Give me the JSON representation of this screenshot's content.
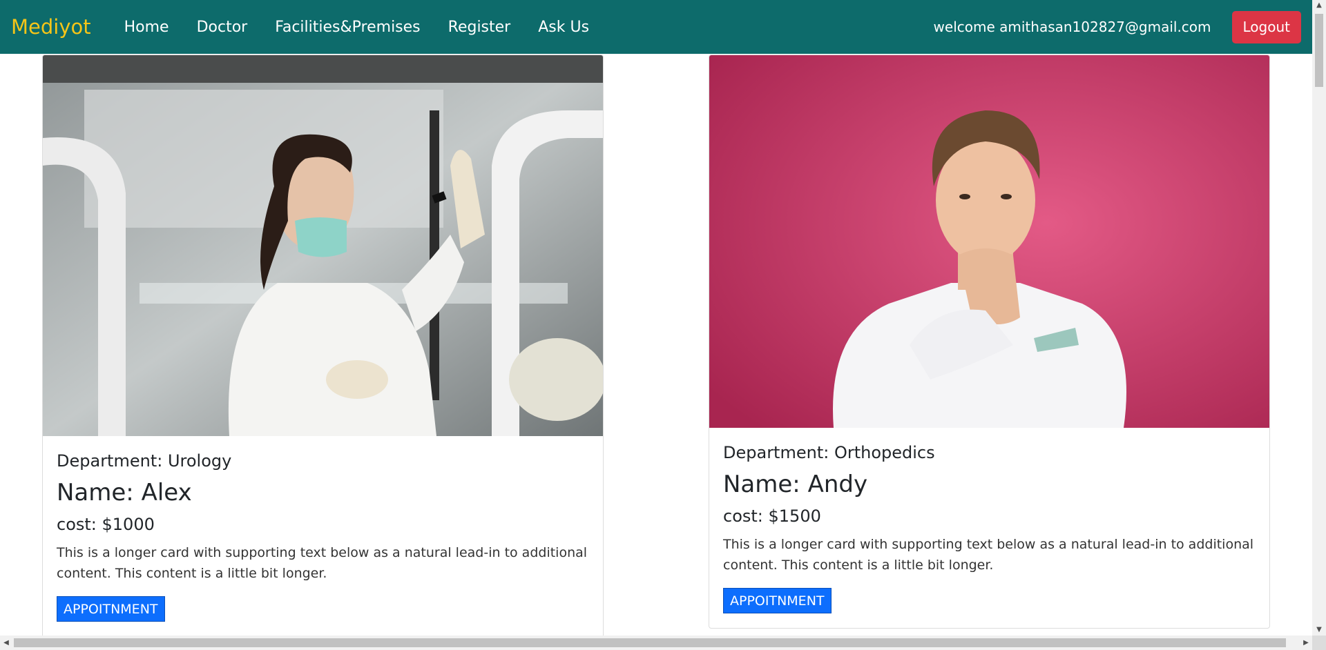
{
  "nav": {
    "brand": "Mediyot",
    "links": [
      "Home",
      "Doctor",
      "Facilities&Premises",
      "Register",
      "Ask Us"
    ],
    "welcome": "welcome amithasan102827@gmail.com",
    "logout_label": "Logout"
  },
  "doctors": [
    {
      "department": "Department: Urology",
      "name": "Name: Alex",
      "cost": "cost: $1000",
      "description": "This is a longer card with supporting text below as a natural lead-in to additional content. This content is a little bit longer.",
      "button_label": "APPOITNMENT"
    },
    {
      "department": "Department: Orthopedics",
      "name": "Name: Andy",
      "cost": "cost: $1500",
      "description": "This is a longer card with supporting text below as a natural lead-in to additional content. This content is a little bit longer.",
      "button_label": "APPOITNMENT"
    }
  ],
  "colors": {
    "navbar": "#0d6b6b",
    "brand": "#f5c518",
    "logout": "#dc3545",
    "appointment": "#0d6efd"
  }
}
